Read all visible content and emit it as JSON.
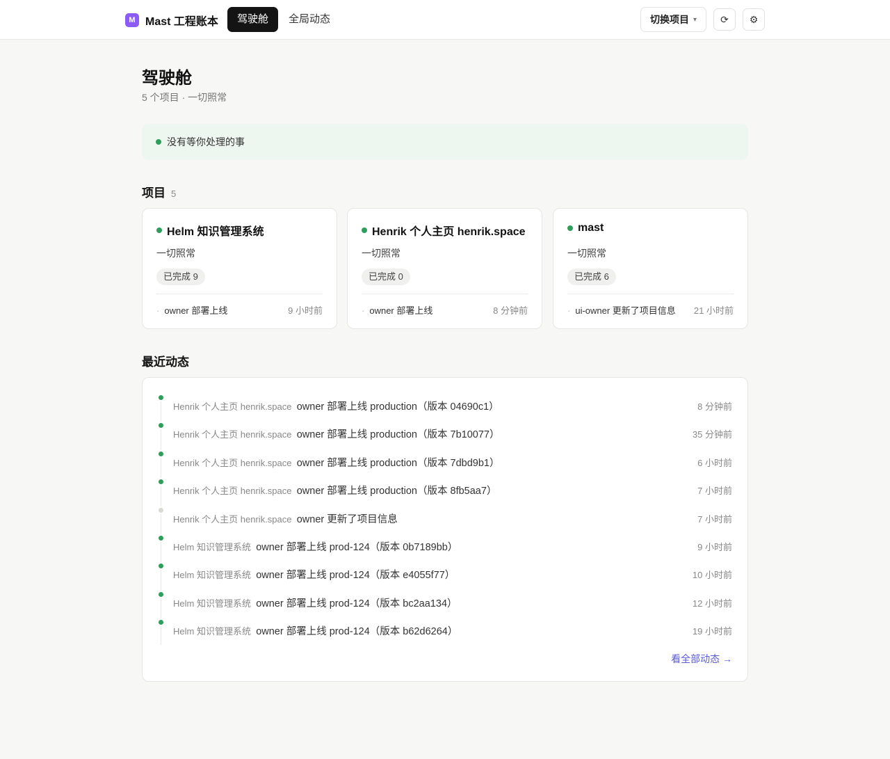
{
  "app": {
    "logo_letter": "M",
    "name": "Mast 工程账本",
    "logo_color": "#8b5cf6"
  },
  "nav": {
    "tabs": [
      {
        "label": "驾驶舱",
        "active": true
      },
      {
        "label": "全局动态",
        "active": false
      }
    ]
  },
  "toolbar": {
    "switch_label": "切换项目",
    "caret": "▾",
    "refresh_icon": "⟳",
    "settings_icon": "⚙"
  },
  "page": {
    "title": "驾驶舱",
    "subtitle": "5 个项目 · 一切照常"
  },
  "notice": {
    "text": "没有等你处理的事",
    "status_color": "#2f9e5a"
  },
  "projects": {
    "heading": "项目",
    "count": "5",
    "items": [
      {
        "name": "Helm 知识管理系统",
        "status": "一切照常",
        "badge": "已完成 9",
        "activity": "owner 部署上线",
        "time": "9 小时前"
      },
      {
        "name": "Henrik 个人主页 henrik.space",
        "status": "一切照常",
        "badge": "已完成 0",
        "activity": "owner 部署上线",
        "time": "8 分钟前"
      },
      {
        "name": "mast",
        "status": "一切照常",
        "badge": "已完成 6",
        "activity": "ui-owner 更新了项目信息",
        "time": "21 小时前"
      }
    ]
  },
  "activity": {
    "heading": "最近动态",
    "items": [
      {
        "project": "Henrik 个人主页 henrik.space",
        "text": "owner 部署上线 production（版本 04690c1）",
        "time": "8 分钟前",
        "muted": false
      },
      {
        "project": "Henrik 个人主页 henrik.space",
        "text": "owner 部署上线 production（版本 7b10077）",
        "time": "35 分钟前",
        "muted": false
      },
      {
        "project": "Henrik 个人主页 henrik.space",
        "text": "owner 部署上线 production（版本 7dbd9b1）",
        "time": "6 小时前",
        "muted": false
      },
      {
        "project": "Henrik 个人主页 henrik.space",
        "text": "owner 部署上线 production（版本 8fb5aa7）",
        "time": "7 小时前",
        "muted": false
      },
      {
        "project": "Henrik 个人主页 henrik.space",
        "text": "owner 更新了项目信息",
        "time": "7 小时前",
        "muted": true
      },
      {
        "project": "Helm 知识管理系统",
        "text": "owner 部署上线 prod-124（版本 0b7189bb）",
        "time": "9 小时前",
        "muted": false
      },
      {
        "project": "Helm 知识管理系统",
        "text": "owner 部署上线 prod-124（版本 e4055f77）",
        "time": "10 小时前",
        "muted": false
      },
      {
        "project": "Helm 知识管理系统",
        "text": "owner 部署上线 prod-124（版本 bc2aa134）",
        "time": "12 小时前",
        "muted": false
      },
      {
        "project": "Helm 知识管理系统",
        "text": "owner 部署上线 prod-124（版本 b62d6264）",
        "time": "19 小时前",
        "muted": false
      }
    ],
    "view_all": "看全部动态 →"
  }
}
